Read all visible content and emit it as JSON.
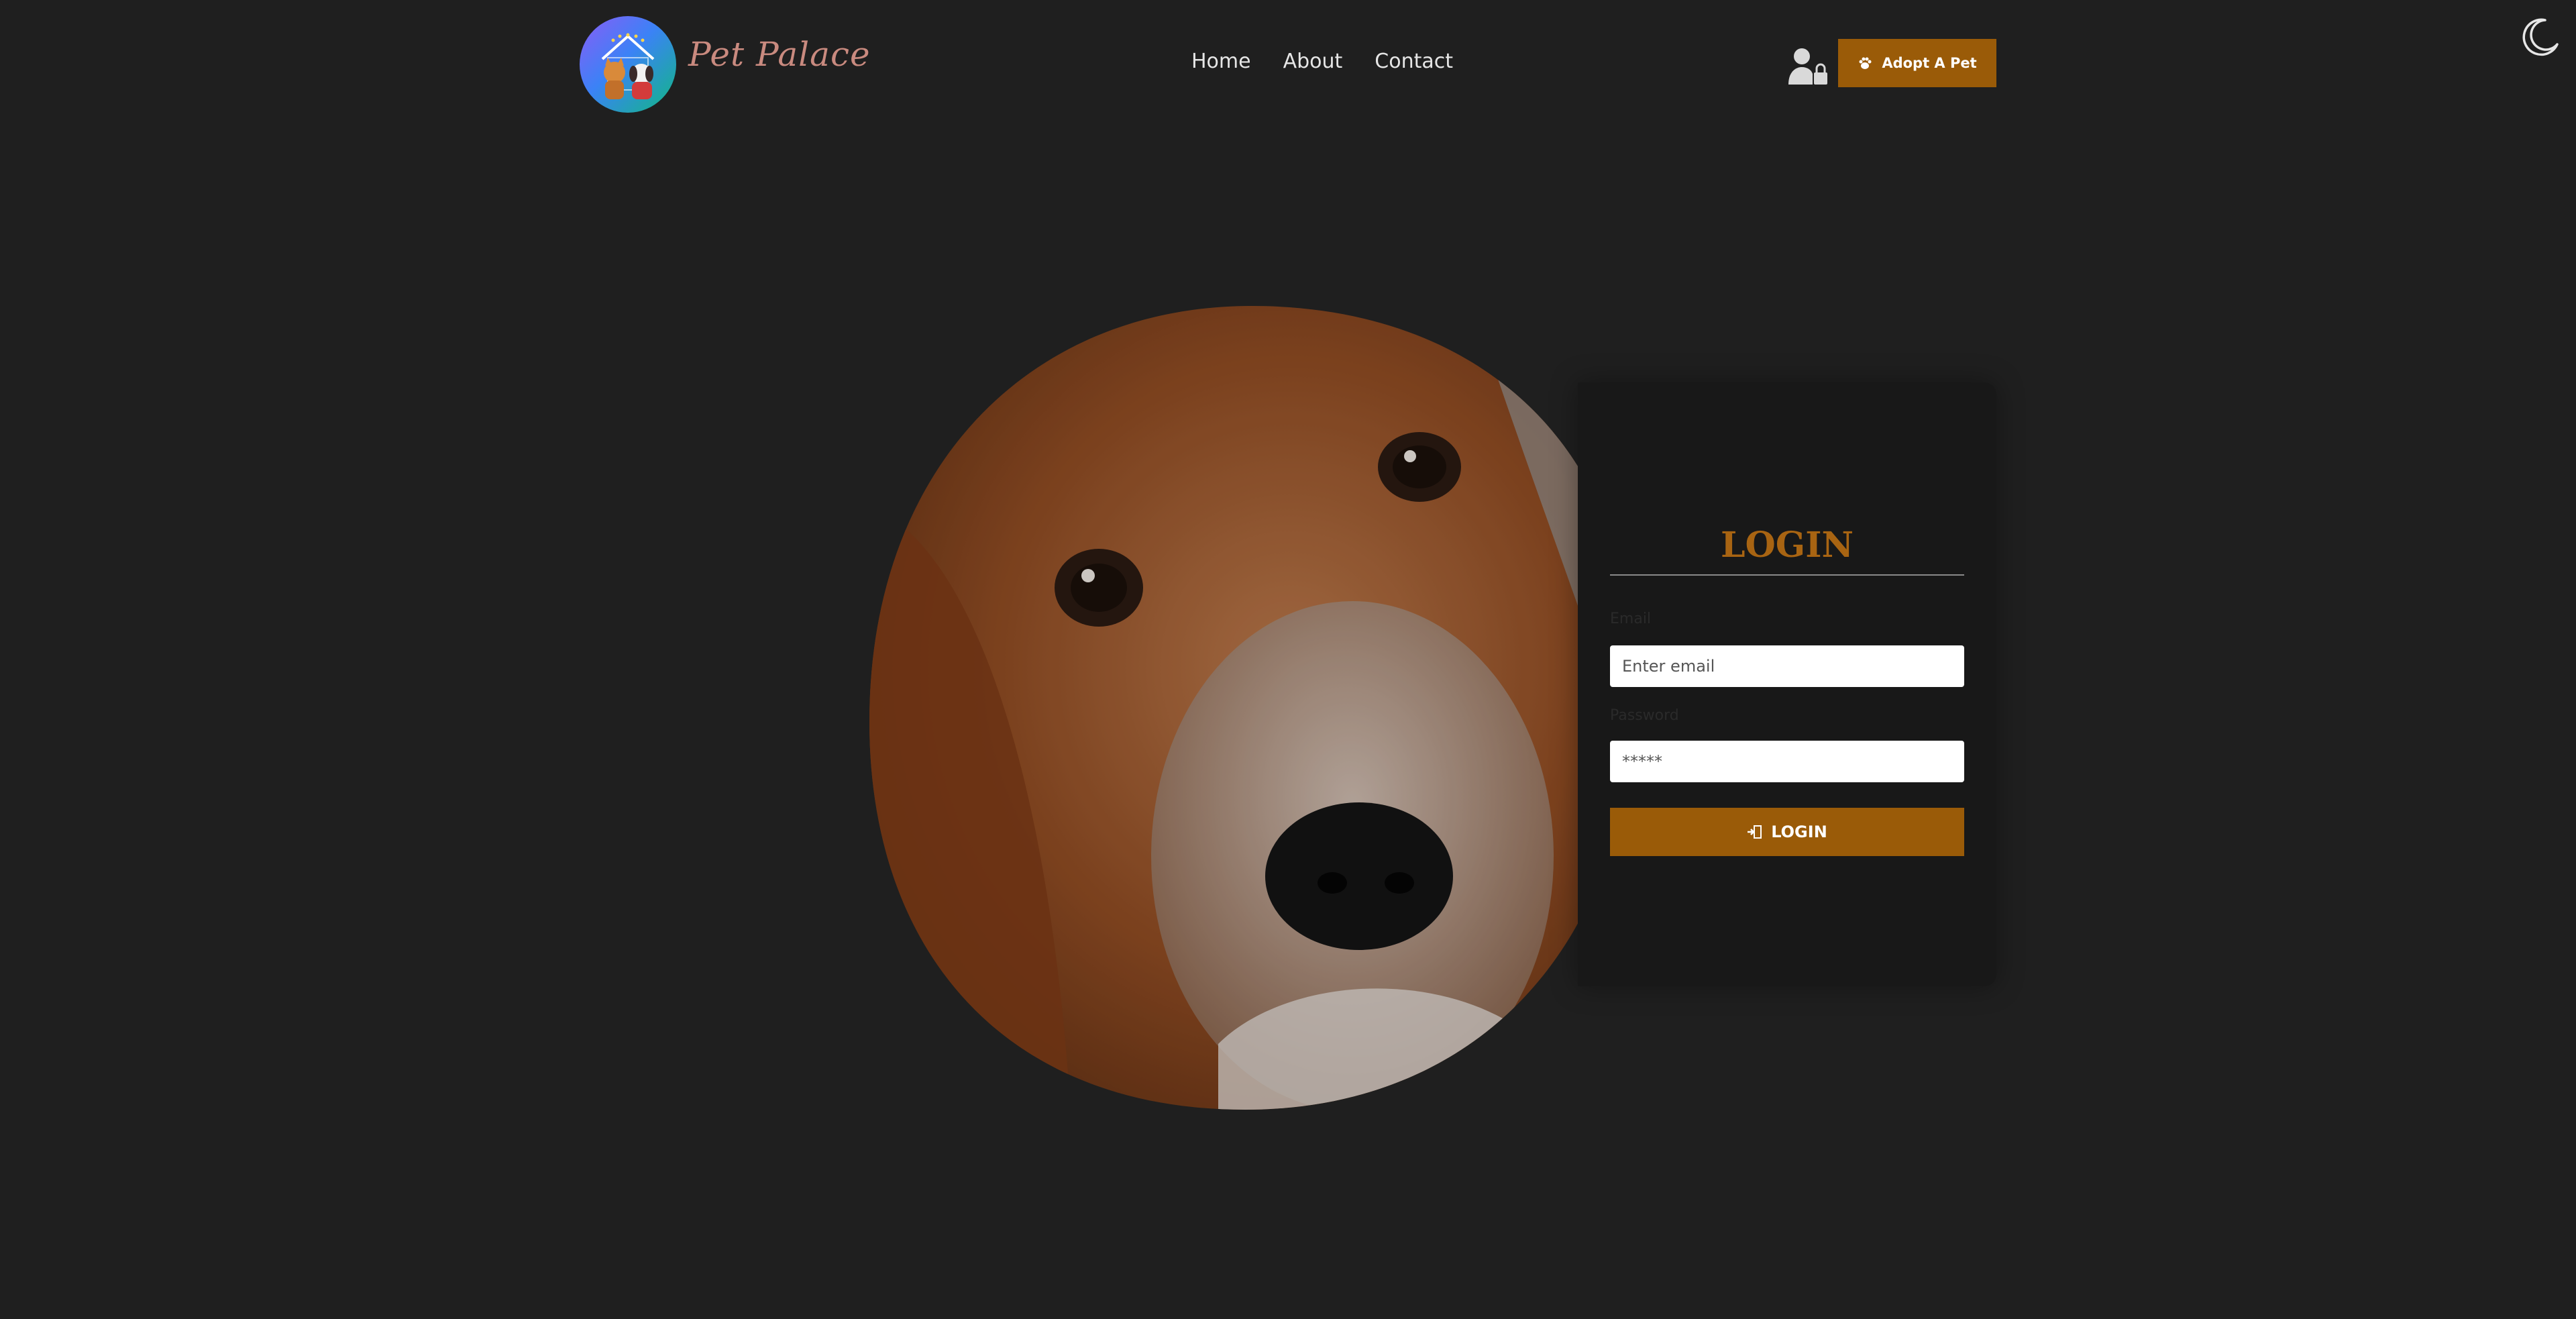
{
  "header": {
    "brand_name": "Pet Palace",
    "nav": [
      "Home",
      "About",
      "Contact"
    ],
    "adopt_button": "Adopt A Pet"
  },
  "login": {
    "title": "LOGIN",
    "email_label": "Email",
    "email_placeholder": "Enter email",
    "password_label": "Password",
    "password_placeholder": "*****",
    "button": "LOGIN"
  },
  "icons": {
    "logo": "pet-palace-logo",
    "user_lock": "user-lock-icon",
    "adopt": "paw-icon",
    "login": "door-enter-icon",
    "theme_toggle": "moon-icon"
  },
  "colors": {
    "background": "#1f1f1f",
    "card": "#181818",
    "accent": "#9a5b08",
    "title": "#a86412"
  }
}
